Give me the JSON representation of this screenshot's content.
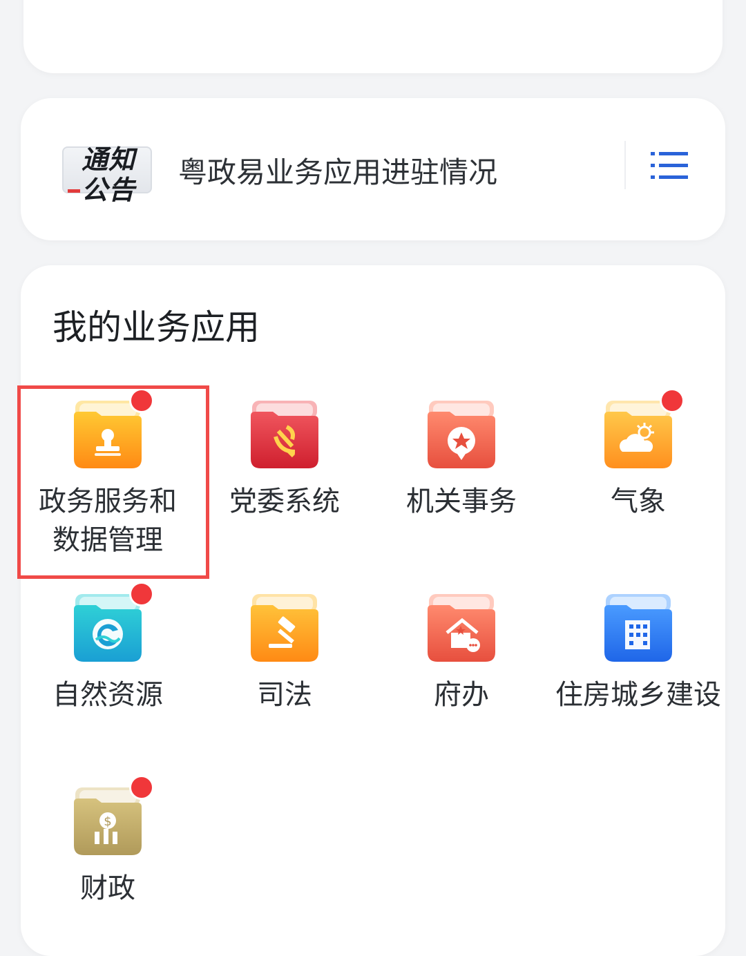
{
  "notice": {
    "badge_line1": "通知",
    "badge_line2": "公告",
    "text": "粤政易业务应用进驻情况"
  },
  "apps_section": {
    "title": "我的业务应用",
    "items": [
      {
        "label": "政务服务和数据管理",
        "icon": "stamp-icon",
        "color_top": "#ffc933",
        "color_bottom": "#ff8a14",
        "badge": true
      },
      {
        "label": "党委系统",
        "icon": "party-emblem-icon",
        "color_top": "#f0565e",
        "color_bottom": "#cf1f2e",
        "badge": false
      },
      {
        "label": "机关事务",
        "icon": "star-badge-icon",
        "color_top": "#ff8a6e",
        "color_bottom": "#e74f3e",
        "badge": false
      },
      {
        "label": "气象",
        "icon": "weather-cloud-icon",
        "color_top": "#ffc84a",
        "color_bottom": "#ff8f1e",
        "badge": true
      },
      {
        "label": "自然资源",
        "icon": "globe-wave-icon",
        "color_top": "#2fd0d6",
        "color_bottom": "#1a9fd4",
        "badge": true
      },
      {
        "label": "司法",
        "icon": "gavel-icon",
        "color_top": "#ffc23a",
        "color_bottom": "#ff8a14",
        "badge": false
      },
      {
        "label": "府办",
        "icon": "government-house-icon",
        "color_top": "#ff8a6e",
        "color_bottom": "#e74f3e",
        "badge": false
      },
      {
        "label": "住房城乡建设",
        "icon": "building-icon",
        "color_top": "#4a9bff",
        "color_bottom": "#1f66e8",
        "badge": false
      },
      {
        "label": "财政",
        "icon": "finance-coin-icon",
        "color_top": "#d6c27e",
        "color_bottom": "#b09a5a",
        "badge": true
      }
    ]
  },
  "colors": {
    "highlight": "#f04a48",
    "badge_red": "#f0373a",
    "list_icon_blue": "#2a63d9"
  }
}
